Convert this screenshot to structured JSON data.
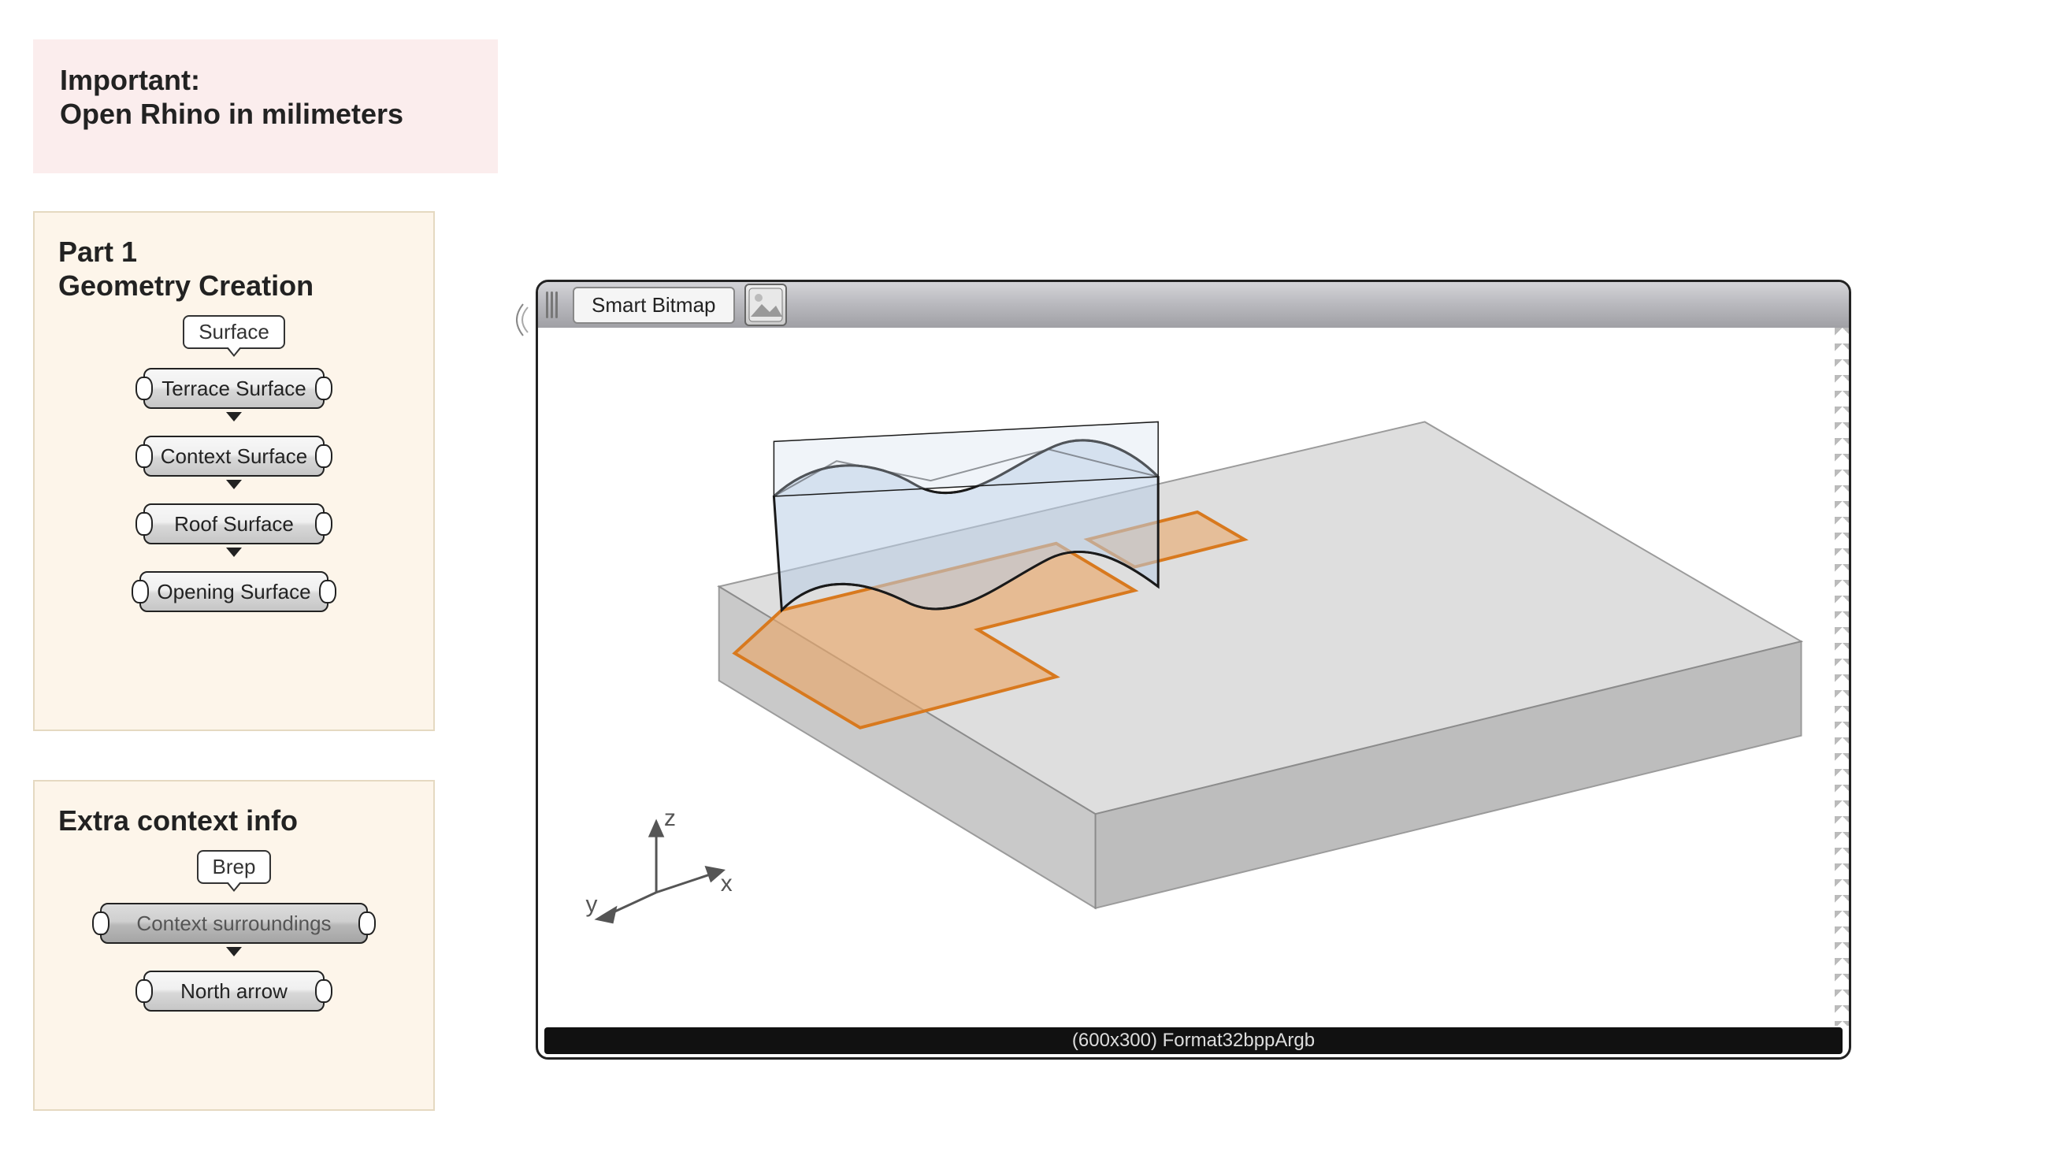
{
  "important": {
    "line1": "Important:",
    "line2": "Open Rhino in milimeters"
  },
  "panel_part1": {
    "title_line1": "Part 1",
    "title_line2": "Geometry Creation",
    "source_label": "Surface",
    "nodes": [
      "Terrace Surface",
      "Context Surface",
      "Roof Surface",
      "Opening Surface"
    ]
  },
  "panel_extra": {
    "title": "Extra context info",
    "source_label": "Brep",
    "nodes": [
      "Context surroundings",
      "North arrow"
    ]
  },
  "bitmap": {
    "title": "Smart Bitmap",
    "status": "(600x300) Format32bppArgb",
    "axes": {
      "x": "x",
      "y": "y",
      "z": "z"
    }
  }
}
